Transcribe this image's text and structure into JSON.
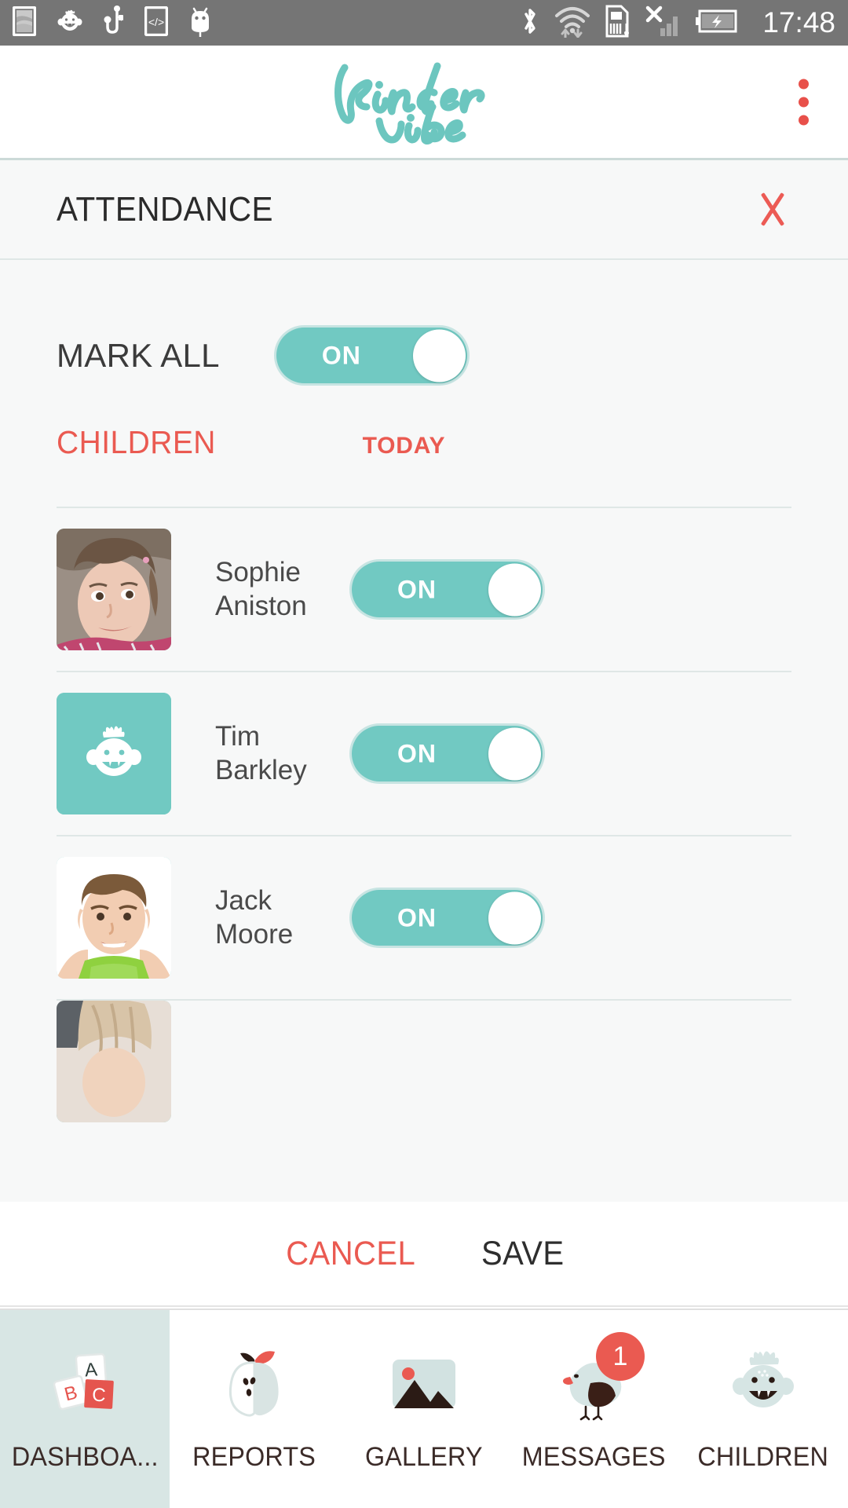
{
  "status_bar": {
    "time": "17:48",
    "left_icons": [
      "screenshot-icon",
      "baby-face-icon",
      "usb-icon",
      "developer-code-icon",
      "android-icon"
    ],
    "right_icons": [
      "bluetooth-icon",
      "wifi-icon",
      "sim-card-alert-icon",
      "signal-no-service-icon",
      "battery-charging-icon"
    ]
  },
  "app_bar": {
    "logo_line1": "kinder",
    "logo_line2": "vibe",
    "logo_color": "#6cc6bf",
    "overflow_menu": "overflow-menu"
  },
  "dialog": {
    "title": "ATTENDANCE",
    "close_label": "close",
    "mark_all": {
      "label": "MARK ALL",
      "toggle_value": "ON"
    },
    "columns": {
      "children": "CHILDREN",
      "today": "TODAY"
    },
    "children": [
      {
        "name_line1": "Sophie",
        "name_line2": "Aniston",
        "toggle_value": "ON",
        "avatar_type": "photo-girl"
      },
      {
        "name_line1": "Tim",
        "name_line2": "Barkley",
        "toggle_value": "ON",
        "avatar_type": "placeholder-baby"
      },
      {
        "name_line1": "Jack",
        "name_line2": "Moore",
        "toggle_value": "ON",
        "avatar_type": "photo-boy"
      },
      {
        "name_line1": "",
        "name_line2": "",
        "toggle_value": "",
        "avatar_type": "photo-blonde"
      }
    ],
    "actions": {
      "cancel": "CANCEL",
      "save": "SAVE"
    }
  },
  "bottom_nav": {
    "items": [
      {
        "label": "DASHBOA...",
        "icon": "abc-blocks-icon",
        "active": true,
        "badge": ""
      },
      {
        "label": "REPORTS",
        "icon": "apple-icon",
        "active": false,
        "badge": ""
      },
      {
        "label": "GALLERY",
        "icon": "image-icon",
        "active": false,
        "badge": ""
      },
      {
        "label": "MESSAGES",
        "icon": "bird-icon",
        "active": false,
        "badge": "1"
      },
      {
        "label": "CHILDREN",
        "icon": "baby-face-icon",
        "active": false,
        "badge": ""
      }
    ]
  },
  "theme": {
    "teal": "#71c9c2",
    "teal_light": "#d8e6e4",
    "coral": "#ea5a51",
    "dark": "#3b2b28",
    "sheet_bg": "#f7f8f8"
  }
}
